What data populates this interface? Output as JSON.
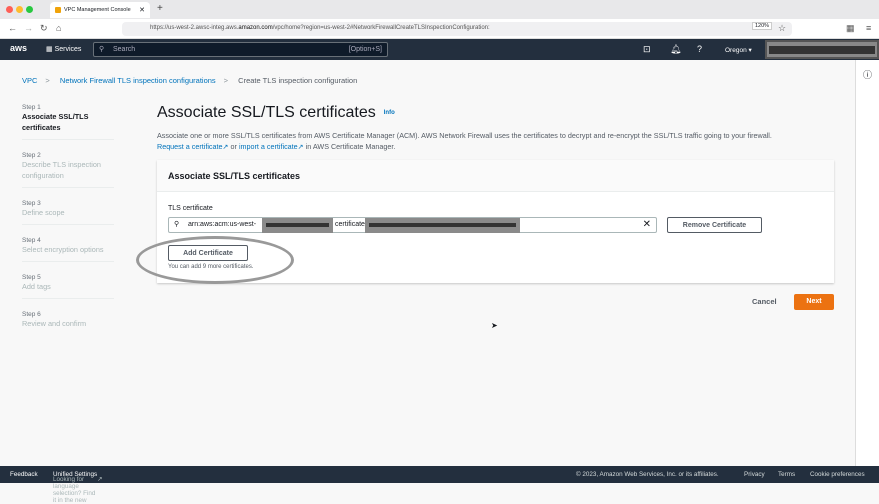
{
  "browser": {
    "tab_title": "VPC Management Console",
    "url_prefix": "https://us-west-2.awsc-integ.aws.",
    "url_domain": "amazon.com",
    "url_path": "/vpc/home?region=us-west-2#NetworkFirewallCreateTLSInspectionConfiguration:",
    "zoom": "120%"
  },
  "nav": {
    "logo": "aws",
    "services": "Services",
    "search_placeholder": "Search",
    "search_shortcut": "[Option+S]",
    "region": "Oregon ▾"
  },
  "breadcrumb": [
    "VPC",
    "Network Firewall TLS inspection configurations",
    "Create TLS inspection configuration"
  ],
  "steps": [
    {
      "n": "Step 1",
      "t": "Associate SSL/TLS certificates"
    },
    {
      "n": "Step 2",
      "t": "Describe TLS inspection configuration"
    },
    {
      "n": "Step 3",
      "t": "Define scope"
    },
    {
      "n": "Step 4",
      "t": "Select encryption options"
    },
    {
      "n": "Step 5",
      "t": "Add tags"
    },
    {
      "n": "Step 6",
      "t": "Review and confirm"
    }
  ],
  "main": {
    "title": "Associate SSL/TLS certificates",
    "info": "Info",
    "desc": "Associate one or more SSL/TLS certificates from AWS Certificate Manager (ACM). AWS Network Firewall uses the certificates to decrypt and re-encrypt the SSL/TLS traffic going to your firewall.",
    "link1": "Request a certificate",
    "or": " or ",
    "link2": "import a certificate",
    "suffix": " in AWS Certificate Manager."
  },
  "panel": {
    "title": "Associate SSL/TLS certificates",
    "label": "TLS certificate",
    "value_start": "arn:aws:acm:us-west-",
    "value_mid": "certificate/7",
    "remove": "Remove Certificate",
    "add": "Add Certificate",
    "hint": "You can add 9 more certificates."
  },
  "actions": {
    "cancel": "Cancel",
    "next": "Next"
  },
  "footer": {
    "feedback": "Feedback",
    "lang": "Looking for language selection? Find it in the new ",
    "unified": "Unified Settings",
    "copyright": "© 2023, Amazon Web Services, Inc. or its affiliates.",
    "privacy": "Privacy",
    "terms": "Terms",
    "cookies": "Cookie preferences"
  }
}
